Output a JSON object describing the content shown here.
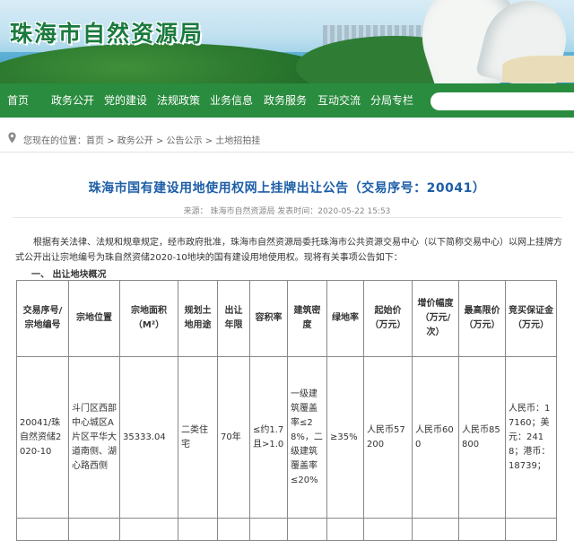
{
  "site": {
    "title": "珠海市自然资源局"
  },
  "nav": {
    "items": [
      "首页",
      "政务公开",
      "党的建设",
      "法规政策",
      "业务信息",
      "政务服务",
      "互动交流",
      "分局专栏"
    ],
    "search_placeholder": ""
  },
  "breadcrumb": {
    "text": "您现在的位置：首页 > 政务公开 > 公告公示 > 土地招拍挂"
  },
  "article": {
    "title": "珠海市国有建设用地使用权网上挂牌出让公告（交易序号：20041）",
    "meta": "来源：  珠海市自然资源局        发表时间：2020-05-22 15:53",
    "paragraph": "根据有关法律、法规和规章规定，经市政府批准，珠海市自然资源局委托珠海市公共资源交易中心（以下简称交易中心）以网上挂牌方式公开出让宗地编号为珠自然资储2020-10地块的国有建设用地使用权。现将有关事项公告如下：",
    "section_heading": "一、 出让地块概况"
  },
  "table": {
    "headers": [
      "交易序号/宗地编号",
      "宗地位置",
      "宗地面积（M²）",
      "规划土地用途",
      "出让年限",
      "容积率",
      "建筑密度",
      "绿地率",
      "起始价（万元）",
      "增价幅度（万元/次）",
      "最高限价（万元）",
      "竞买保证金（万元）"
    ],
    "row": [
      "20041/珠自然资储2020-10",
      "斗门区西部中心城区A片区平华大道南侧、湖心路西侧",
      "35333.04",
      "二类住宅",
      "70年",
      "≤约1.7且>1.0",
      "一级建筑覆盖率≤28%，二级建筑覆盖率≤20%",
      "≥35%",
      "人民币57200",
      "人民币600",
      "人民币85800",
      "人民币：17160；美元：2418；港币：18739；"
    ]
  },
  "colors": {
    "nav_green": "#2a8c3f",
    "title_blue": "#1d5ea7",
    "brand_green": "#1b7a3e"
  }
}
